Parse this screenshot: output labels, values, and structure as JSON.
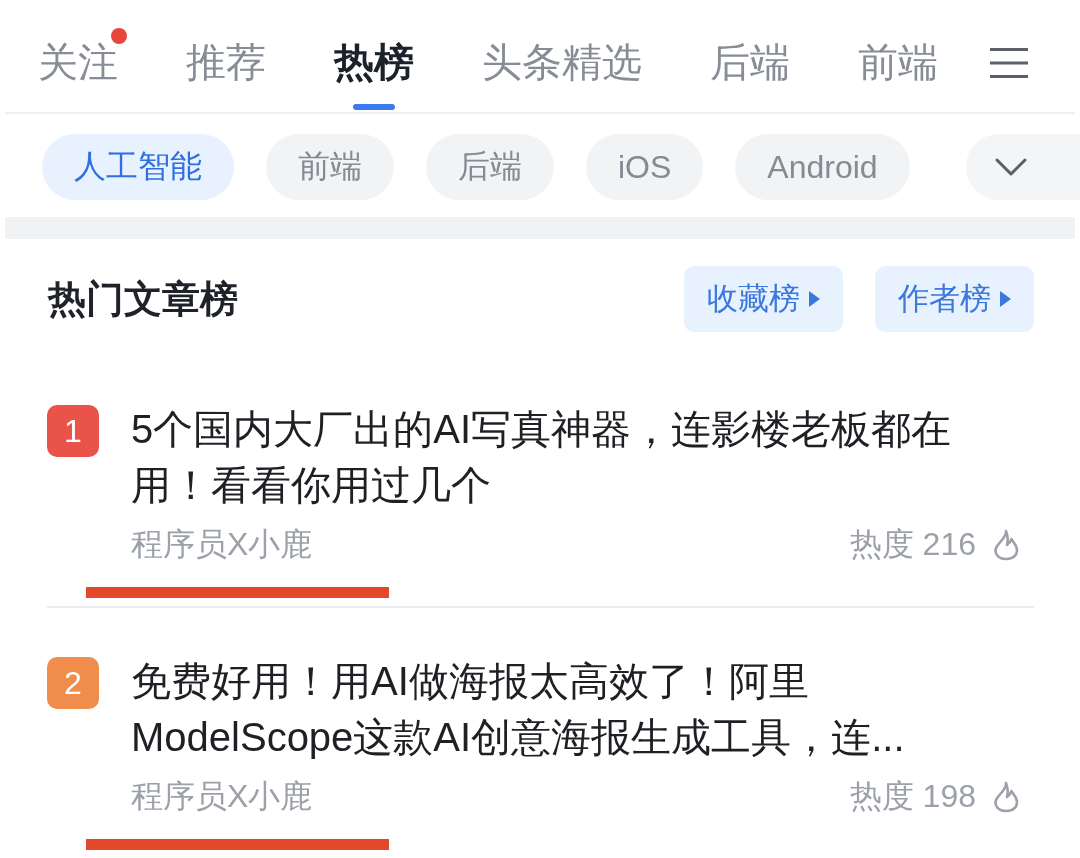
{
  "top_tabs": [
    {
      "label": "关注",
      "selected": false,
      "dot": true
    },
    {
      "label": "推荐",
      "selected": false,
      "dot": false
    },
    {
      "label": "热榜",
      "selected": true,
      "dot": false
    },
    {
      "label": "头条精选",
      "selected": false,
      "dot": false
    },
    {
      "label": "后端",
      "selected": false,
      "dot": false
    },
    {
      "label": "前端",
      "selected": false,
      "dot": false
    }
  ],
  "categories": [
    {
      "label": "人工智能",
      "selected": true
    },
    {
      "label": "前端",
      "selected": false
    },
    {
      "label": "后端",
      "selected": false
    },
    {
      "label": "iOS",
      "selected": false
    },
    {
      "label": "Android",
      "selected": false
    }
  ],
  "section": {
    "title": "热门文章榜",
    "links": [
      "收藏榜",
      "作者榜"
    ]
  },
  "articles": [
    {
      "rank": "1",
      "color": "#e9534a",
      "title": "5个国内大厂出的AI写真神器，连影楼老板都在用！看看你用过几个",
      "author": "程序员X小鹿",
      "underlined": true,
      "heat": "热度 216"
    },
    {
      "rank": "2",
      "color": "#f08c4c",
      "title": "免费好用！用AI做海报太高效了！阿里ModelScope这款AI创意海报生成工具，连...",
      "author": "程序员X小鹿",
      "underlined": true,
      "heat": "热度 198"
    }
  ]
}
